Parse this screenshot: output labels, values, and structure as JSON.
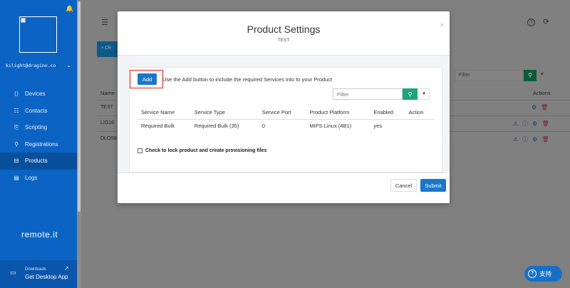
{
  "sidebar": {
    "user": "kilight@dragino.co",
    "items": [
      {
        "label": "Devices",
        "icon": "devices-icon",
        "glyph": "⟨⟩"
      },
      {
        "label": "Contacts",
        "icon": "contacts-icon",
        "glyph": "☷"
      },
      {
        "label": "Scripting",
        "icon": "scripting-icon",
        "glyph": "⎘"
      },
      {
        "label": "Registrations",
        "icon": "registrations-icon",
        "glyph": "⚲"
      },
      {
        "label": "Products",
        "icon": "products-icon",
        "glyph": "⊟"
      },
      {
        "label": "Logs",
        "icon": "logs-icon",
        "glyph": "▤"
      }
    ],
    "brand": "remote.it",
    "downloads_label": "Downloads",
    "desktop_app_label": "Get Desktop App"
  },
  "background": {
    "create_label": "+ CR",
    "filter_placeholder": "Filter",
    "col_name": "Name",
    "col_actions": "Actions",
    "rows": [
      "TEST",
      "LIG16",
      "DLOS8"
    ]
  },
  "modal": {
    "title": "Product Settings",
    "subtitle": "TEST",
    "add_label": "Add",
    "hint": "Use the Add button to include the required Services into to your Product",
    "filter_placeholder": "Filter",
    "columns": [
      "Service Name",
      "Service Type",
      "Service Port",
      "Product Platform",
      "Enabled",
      "Action"
    ],
    "rows": [
      [
        "Required Bulk",
        "Required Bulk (35)",
        "0",
        "MIPS Linux (4B1)",
        "yes",
        ""
      ]
    ],
    "lock_label": "Check to lock product and create provisioning files",
    "cancel_label": "Cancel",
    "submit_label": "Submit"
  },
  "support_label": "支持",
  "colors": {
    "sidebar": "#0b63c4",
    "primary": "#1b78c9",
    "search_green": "#1ea57a",
    "highlight_red": "#e0211c"
  }
}
